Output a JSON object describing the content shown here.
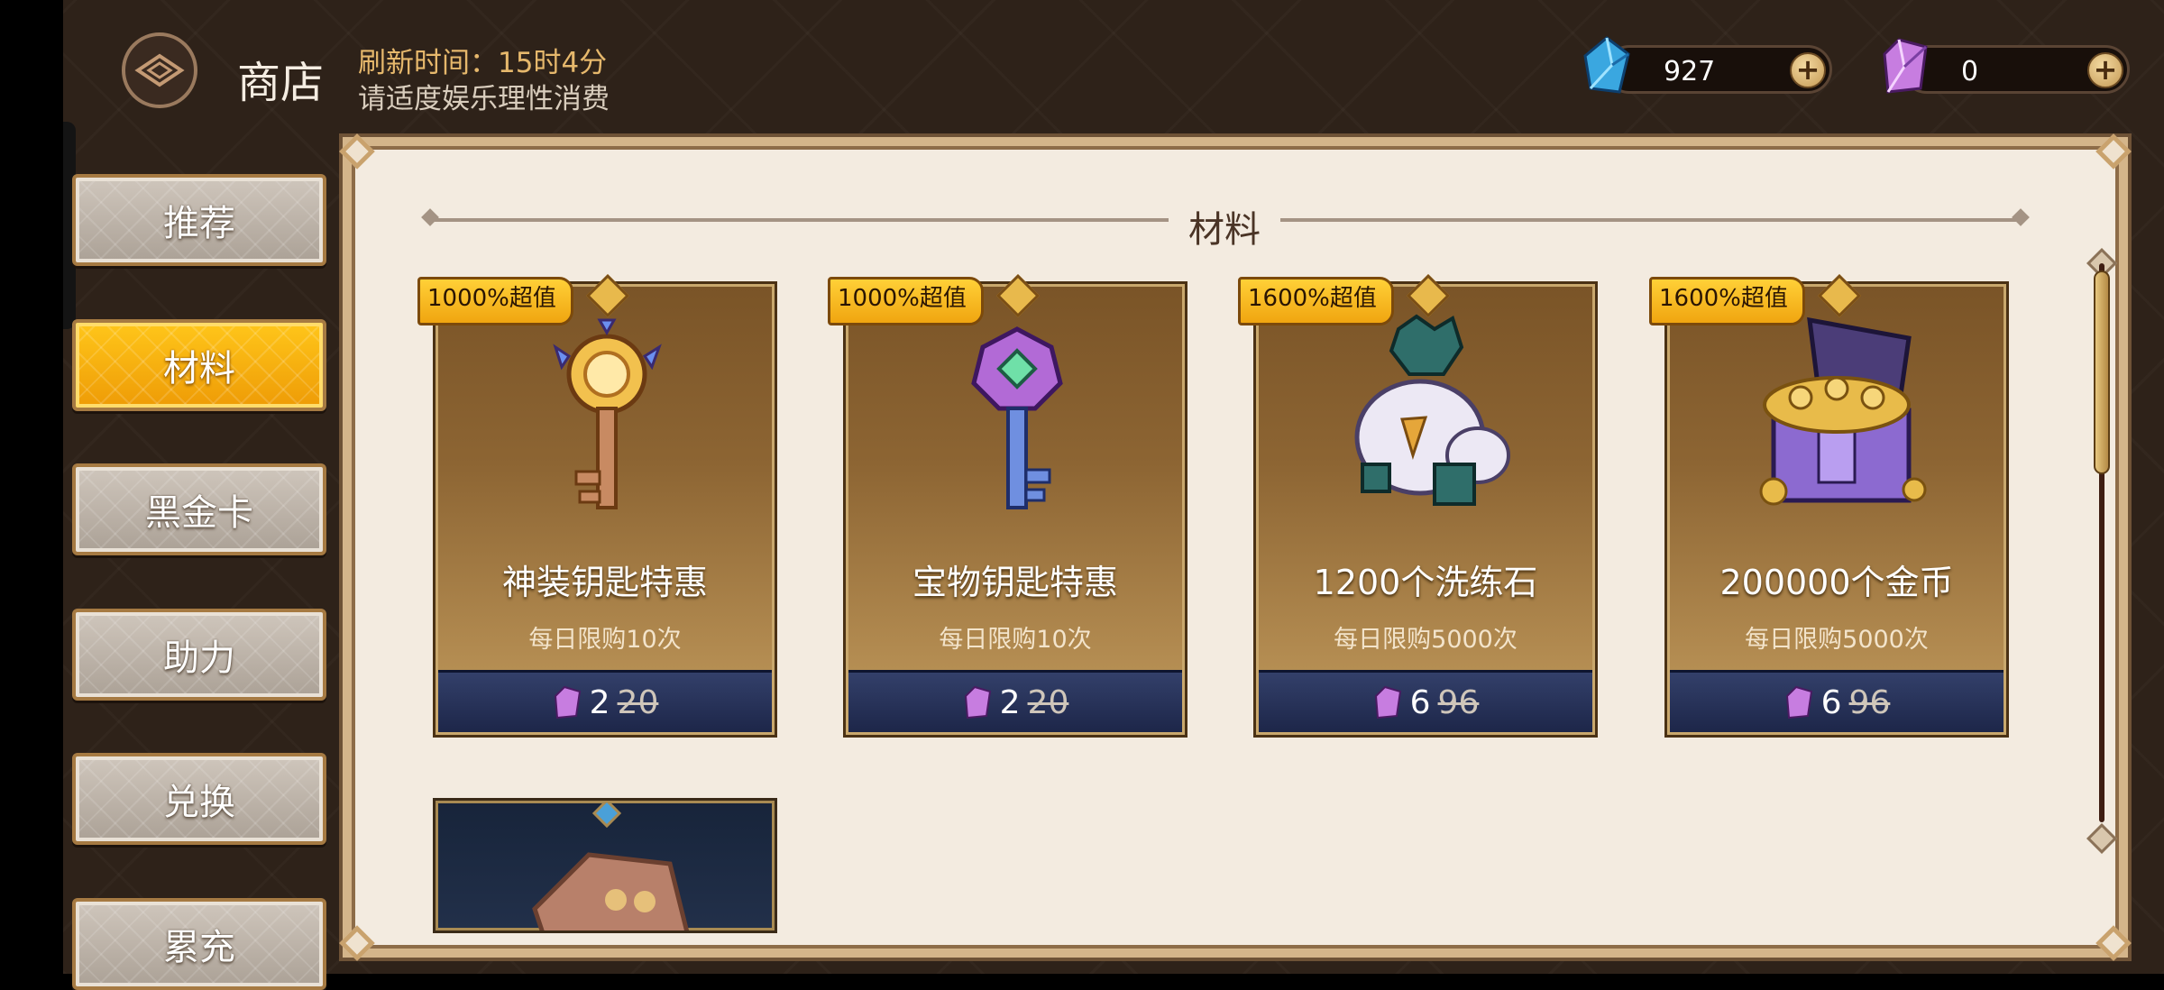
{
  "header": {
    "title": "商店",
    "refresh_text": "刷新时间：15时4分",
    "notice": "请适度娱乐理性消费",
    "currencies": [
      {
        "icon": "blue-crystal-icon",
        "value": "927"
      },
      {
        "icon": "pink-crystal-icon",
        "value": "0"
      }
    ],
    "plus_label": "+"
  },
  "sidebar": {
    "items": [
      {
        "label": "推荐",
        "active": false
      },
      {
        "label": "材料",
        "active": true
      },
      {
        "label": "黑金卡",
        "active": false
      },
      {
        "label": "助力",
        "active": false
      },
      {
        "label": "兑换",
        "active": false
      },
      {
        "label": "累充",
        "active": false
      }
    ]
  },
  "section": {
    "title": "材料"
  },
  "products": [
    {
      "badge": "1000%超值",
      "name": "神装钥匙特惠",
      "limit": "每日限购10次",
      "price": "2",
      "original_price": "20",
      "icon": "golden-key-icon"
    },
    {
      "badge": "1000%超值",
      "name": "宝物钥匙特惠",
      "limit": "每日限购10次",
      "price": "2",
      "original_price": "20",
      "icon": "crystal-key-icon"
    },
    {
      "badge": "1600%超值",
      "name": "1200个洗练石",
      "limit": "每日限购5000次",
      "price": "6",
      "original_price": "96",
      "icon": "stone-bag-icon"
    },
    {
      "badge": "1600%超值",
      "name": "200000个金币",
      "limit": "每日限购5000次",
      "price": "6",
      "original_price": "96",
      "icon": "gold-chest-icon"
    }
  ],
  "colors": {
    "background": "#2e2219",
    "active_tab": "#f5b10d",
    "badge": "#ffc52b",
    "price_bar": "#26305a",
    "panel": "#f3ebe0"
  }
}
